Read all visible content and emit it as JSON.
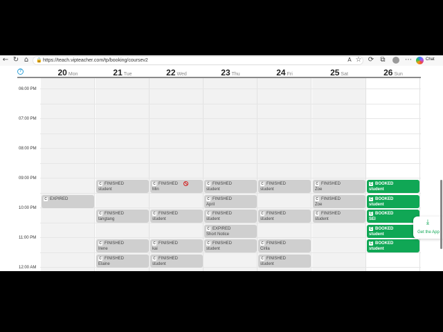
{
  "browser": {
    "url": "https://teach.vipteacher.com/tp/booking/coursev2",
    "chat_label": "Chat",
    "icons": [
      "back-icon",
      "refresh-icon",
      "home-icon",
      "lock-icon",
      "read-aloud-icon",
      "favorite-icon",
      "extensions-icon",
      "profile-icon",
      "copilot-icon"
    ]
  },
  "calendar": {
    "help_icon": "?",
    "days": [
      {
        "num": "20",
        "name": "Mon"
      },
      {
        "num": "21",
        "name": "Tue"
      },
      {
        "num": "22",
        "name": "Wed"
      },
      {
        "num": "23",
        "name": "Thu"
      },
      {
        "num": "24",
        "name": "Fri"
      },
      {
        "num": "25",
        "name": "Sat"
      },
      {
        "num": "26",
        "name": "Sun"
      }
    ],
    "times": [
      "06:00 PM",
      "07:00 PM",
      "08:00 PM",
      "09:00 PM",
      "10:00 PM",
      "11:00 PM",
      "12:00 AM"
    ],
    "badge_letter": "C",
    "events": [
      {
        "day": 0,
        "slot": 1,
        "status": "EXPIRED",
        "student": "",
        "color": "grey"
      },
      {
        "day": 1,
        "slot": 0,
        "status": "FINISHED",
        "student": "student",
        "color": "grey"
      },
      {
        "day": 1,
        "slot": 2,
        "status": "FINISHED",
        "student": "tangtang",
        "color": "grey"
      },
      {
        "day": 1,
        "slot": 4,
        "status": "FINISHED",
        "student": "Irene",
        "color": "grey"
      },
      {
        "day": 1,
        "slot": 5,
        "status": "FINISHED",
        "student": "Elaine",
        "color": "grey"
      },
      {
        "day": 2,
        "slot": 0,
        "status": "FINISHED",
        "student": "Min",
        "color": "grey",
        "banned": true
      },
      {
        "day": 2,
        "slot": 2,
        "status": "FINISHED",
        "student": "student",
        "color": "grey"
      },
      {
        "day": 2,
        "slot": 4,
        "status": "FINISHED",
        "student": "kai",
        "color": "grey"
      },
      {
        "day": 2,
        "slot": 5,
        "status": "FINISHED",
        "student": "student",
        "color": "grey"
      },
      {
        "day": 3,
        "slot": 0,
        "status": "FINISHED",
        "student": "student",
        "color": "grey"
      },
      {
        "day": 3,
        "slot": 1,
        "status": "FINISHED",
        "student": "April",
        "color": "grey"
      },
      {
        "day": 3,
        "slot": 2,
        "status": "FINISHED",
        "student": "student",
        "color": "grey"
      },
      {
        "day": 3,
        "slot": 3,
        "status": "EXPIRED",
        "student": "Short Notice",
        "color": "grey"
      },
      {
        "day": 3,
        "slot": 4,
        "status": "FINISHED",
        "student": "student",
        "color": "grey"
      },
      {
        "day": 4,
        "slot": 0,
        "status": "FINISHED",
        "student": "student",
        "color": "grey"
      },
      {
        "day": 4,
        "slot": 2,
        "status": "FINISHED",
        "student": "student",
        "color": "grey"
      },
      {
        "day": 4,
        "slot": 4,
        "status": "FINISHED",
        "student": "Cirila",
        "color": "grey"
      },
      {
        "day": 4,
        "slot": 5,
        "status": "FINISHED",
        "student": "student",
        "color": "grey"
      },
      {
        "day": 5,
        "slot": 0,
        "status": "FINISHED",
        "student": "Zoe",
        "color": "grey"
      },
      {
        "day": 5,
        "slot": 1,
        "status": "FINISHED",
        "student": "Zoe",
        "color": "grey"
      },
      {
        "day": 5,
        "slot": 2,
        "status": "FINISHED",
        "student": "student",
        "color": "grey"
      },
      {
        "day": 6,
        "slot": 0,
        "status": "BOOKED",
        "student": "student",
        "color": "green"
      },
      {
        "day": 6,
        "slot": 1,
        "status": "BOOKED",
        "student": "student",
        "color": "green"
      },
      {
        "day": 6,
        "slot": 2,
        "status": "BOOKED",
        "student": "SEI",
        "color": "green"
      },
      {
        "day": 6,
        "slot": 3,
        "status": "BOOKED",
        "student": "student",
        "color": "green"
      },
      {
        "day": 6,
        "slot": 4,
        "status": "BOOKED",
        "student": "student",
        "color": "green"
      }
    ]
  },
  "get_app": {
    "label": "Get the App",
    "icon": "download-icon"
  },
  "colors": {
    "booked": "#10a755",
    "finished": "#cfcfcf",
    "accent": "#2b9fd8"
  }
}
